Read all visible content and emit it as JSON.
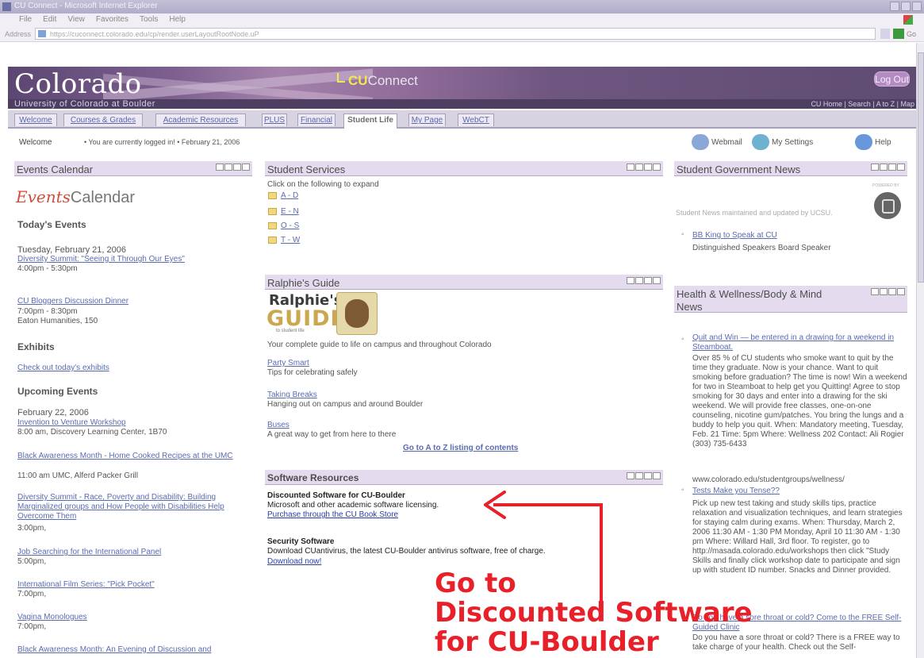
{
  "browser": {
    "title": "CU Connect - Microsoft Internet Explorer",
    "menu": [
      "File",
      "Edit",
      "View",
      "Favorites",
      "Tools",
      "Help"
    ],
    "address_label": "Address",
    "url": "https://cuconnect.colorado.edu/cp/render.userLayoutRootNode.uP",
    "go_label": "Go"
  },
  "header": {
    "logo": "Colorado",
    "app_name_prefix": "CU",
    "app_name_rest": "Connect",
    "logout": "Log Out",
    "university": "University of Colorado at Boulder",
    "site_links": "CU Home | Search | A to Z | Map"
  },
  "tabs": [
    "Welcome",
    "Courses & Grades",
    "Academic Resources",
    "PLUS",
    "Financial",
    "Student Life",
    "My Page",
    "WebCT"
  ],
  "status": {
    "welcome": "Welcome",
    "logged_in": "• You are currently logged in! • February 21, 2006",
    "webmail": "Webmail",
    "settings": "My Settings",
    "help": "Help"
  },
  "events": {
    "title": "Events Calendar",
    "logo_script": "Events",
    "logo_text": "Calendar",
    "todays_heading": "Today's Events",
    "today_date": "Tuesday, February 21, 2006",
    "e1_link": "Diversity Summit: \"Seeing it Through Our Eyes\"",
    "e1_time": "4:00pm - 5:30pm",
    "e2_link": "CU Bloggers Discussion Dinner",
    "e2_time": "7:00pm - 8:30pm",
    "e2_place": "Eaton Humanities, 150",
    "exhibits_heading": "Exhibits",
    "exhibits_link": "Check out today's exhibits",
    "upcoming_heading": "Upcoming Events",
    "up_date": "February 22, 2006",
    "u1_link": "Invention to Venture Workshop",
    "u1_time": "8:00 am, Discovery Learning Center, 1B70",
    "u2_link": "Black Awareness Month - Home Cooked Recipes at the UMC",
    "u2_time": "11:00 am UMC, Alferd Packer Grill",
    "u3_link": "Diversity Summit - Race, Poverty and Disability: Building Marginalized groups and How People with Disabilities Help Overcome Them",
    "u3_time": "3:00pm,",
    "u4_link": "Job Searching for the International Panel",
    "u4_time": "5:00pm,",
    "u5_link": "International Film Series: \"Pick Pocket\"",
    "u5_time": "7:00pm,",
    "u6_link": "Vagina Monologues",
    "u6_time": "7:00pm,",
    "u7_link": "Black Awareness Month: An Evening of Discussion and"
  },
  "services": {
    "title": "Student Services",
    "intro": "Click on the following to expand",
    "folders": [
      "A - D",
      "E - N",
      "O - S",
      "T - W"
    ]
  },
  "ralphie": {
    "title": "Ralphie's Guide",
    "logo_line1": "Ralphie's",
    "logo_line2": "GUIDE",
    "logo_line3": "to student life",
    "tagline": "Your complete guide to life on campus and throughout Colorado",
    "l1": "Party Smart",
    "d1": "Tips for celebrating safely",
    "l2": "Taking Breaks",
    "d2": "Hanging out on campus and around Boulder",
    "l3": "Buses",
    "d3": "A great way to get from here to there",
    "atoz": "Go to A to Z listing of contents"
  },
  "software": {
    "title": "Software Resources",
    "h1": "Discounted Software for CU-Boulder",
    "d1": "Microsoft and other academic software licensing.",
    "l1": "Purchase through the CU Book Store",
    "h2": "Security Software",
    "d2": "Download CUantivirus, the latest CU-Boulder antivirus software, free of charge.",
    "l2": "Download now!"
  },
  "sgnews": {
    "title": "Student Government News",
    "small": "POWERED BY",
    "maintained": "Student News maintained and updated by UCSU.",
    "item_link": "BB King to Speak at CU",
    "item_desc": "Distinguished Speakers Board Speaker"
  },
  "health": {
    "title": "Health & Wellness/Body & Mind News",
    "i1_link": "Quit and Win — be entered in a drawing for a weekend in Steamboat.",
    "i1_body": "Over 85 % of CU students who smoke want to quit by the time they graduate. Now is your chance. Want to quit smoking before graduation? The time is now! Win a weekend for two in Steamboat to help get you Quitting! Agree to stop smoking for 30 days and enter into a drawing for the ski weekend. We will provide free classes, one-on-one counseling, nicotine gum/patches. You bring the lungs and a buddy to help you quit. When: Mandatory meeting, Tuesday, Feb. 21 Time: 5pm Where: Wellness 202 Contact: Ali Rogier (303) 735-6433",
    "i1_url": "www.colorado.edu/studentgroups/wellness/",
    "i2_link": "Tests Make you Tense??",
    "i2_body": "Pick up new test taking and study skills tips, practice relaxation and visualization techniques, and learn strategies for staying calm during exams. When: Thursday, March 2, 2006 11:30 AM - 1:30 PM Monday, April 10 11:30 AM - 1:30 pm Where: Willard Hall, 3rd floor. To register, go to http://masada.colorado.edu/workshops then click \"Study Skills and finally click workshop date to participate and sign up with student ID number. Snacks and Dinner provided.",
    "i3_link": "Do you have a sore throat or cold? Come to the FREE Self-Guided Clinic",
    "i3_body": "Do you have a sore throat or cold? There is a FREE way to take charge of your health. Check out the Self-"
  },
  "annotation": {
    "line1": "Go to",
    "line2": "Discounted Software",
    "line3": "for CU-Boulder"
  },
  "colors": {
    "annotation": "#e8202a",
    "link": "#5a6bb0",
    "portlet_header": "#e4dcee",
    "banner": "#6e5680"
  }
}
